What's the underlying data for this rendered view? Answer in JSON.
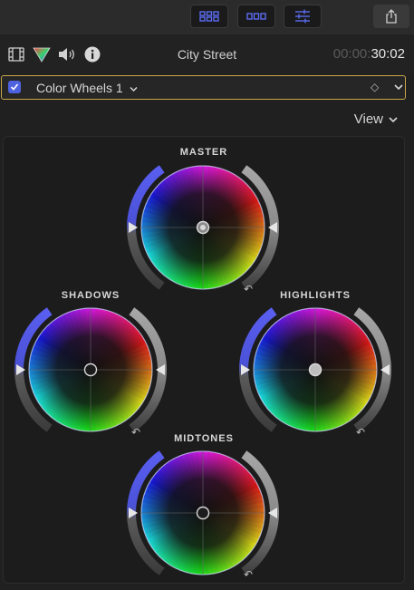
{
  "toolbar": {
    "buttons": [
      "grid-view-icon",
      "filmstrip-view-icon",
      "inspector-sliders-icon"
    ],
    "share_icon": "share-icon"
  },
  "inspector": {
    "icons": [
      "video-inspector-icon",
      "color-inspector-icon",
      "audio-inspector-icon",
      "info-inspector-icon"
    ],
    "clip_name": "City Street",
    "timecode_dim": "00:00:",
    "timecode_bright": "30:02"
  },
  "effect": {
    "enabled": true,
    "name": "Color Wheels 1",
    "keyframe_glyph": "◇"
  },
  "view_menu": {
    "label": "View"
  },
  "wheels": {
    "master": {
      "label": "MASTER",
      "puck_fill": "#8a8a8a"
    },
    "shadows": {
      "label": "SHADOWS",
      "puck_fill": "#1c1c1c"
    },
    "highlights": {
      "label": "HIGHLIGHTS",
      "puck_fill": "#bdbdbd"
    },
    "midtones": {
      "label": "MIDTONES",
      "puck_fill": "#1c1c1c"
    }
  },
  "colors": {
    "accent_blue": "#4e62e0",
    "selection_border": "#c8a64a",
    "panel_bg": "#1c1c1c"
  }
}
